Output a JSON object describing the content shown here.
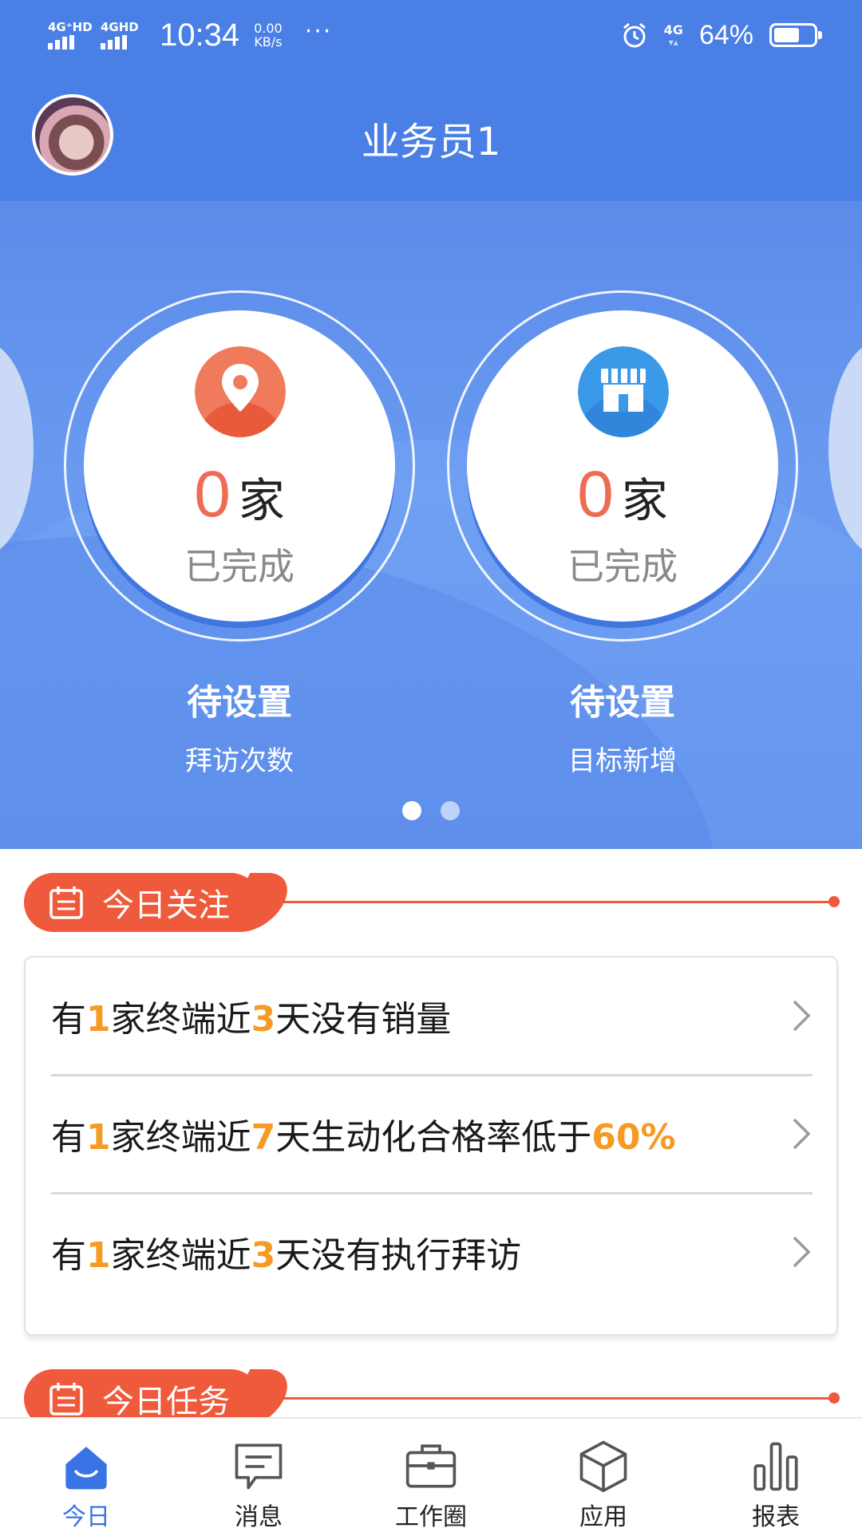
{
  "status_bar": {
    "sim1": "4G⁺HD",
    "sim2": "4GHD",
    "time": "10:34",
    "net_speed_value": "0.00",
    "net_speed_unit": "KB/s",
    "more": "···",
    "network": "4G",
    "battery_percent": "64%",
    "battery_level": 0.64
  },
  "header": {
    "title": "业务员1",
    "avatar_icon": "user-avatar"
  },
  "carousel": {
    "cards": [
      {
        "icon": "location-pin-icon",
        "value": "0",
        "unit": "家",
        "completed_label": "已完成",
        "status": "待设置",
        "metric": "拜访次数"
      },
      {
        "icon": "store-icon",
        "value": "0",
        "unit": "家",
        "completed_label": "已完成",
        "status": "待设置",
        "metric": "目标新增"
      }
    ],
    "page_count": 2,
    "active_page": 1
  },
  "focus_section": {
    "title": "今日关注",
    "icon": "calendar-icon",
    "items": [
      {
        "t1": "有",
        "n1": "1",
        "t2": "家终端近",
        "n2": "3",
        "t3": "天没有销量",
        "n3": ""
      },
      {
        "t1": "有",
        "n1": "1",
        "t2": "家终端近",
        "n2": "7",
        "t3": "天生动化合格率低于",
        "n3": "60%"
      },
      {
        "t1": "有",
        "n1": "1",
        "t2": "家终端近",
        "n2": "3",
        "t3": "天没有执行拜访",
        "n3": ""
      }
    ]
  },
  "task_section": {
    "title": "今日任务",
    "icon": "calendar-icon"
  },
  "tab_bar": {
    "tabs": [
      {
        "label": "今日",
        "icon": "home-icon",
        "active": true
      },
      {
        "label": "消息",
        "icon": "message-icon",
        "active": false
      },
      {
        "label": "工作圈",
        "icon": "briefcase-icon",
        "active": false
      },
      {
        "label": "应用",
        "icon": "cube-icon",
        "active": false
      },
      {
        "label": "报表",
        "icon": "bar-chart-icon",
        "active": false
      }
    ]
  },
  "colors": {
    "primary": "#4a7fe6",
    "accent_orange": "#f05a3c",
    "highlight": "#f59a22",
    "value_red": "#ee6b54",
    "tab_active": "#3a73e6"
  }
}
